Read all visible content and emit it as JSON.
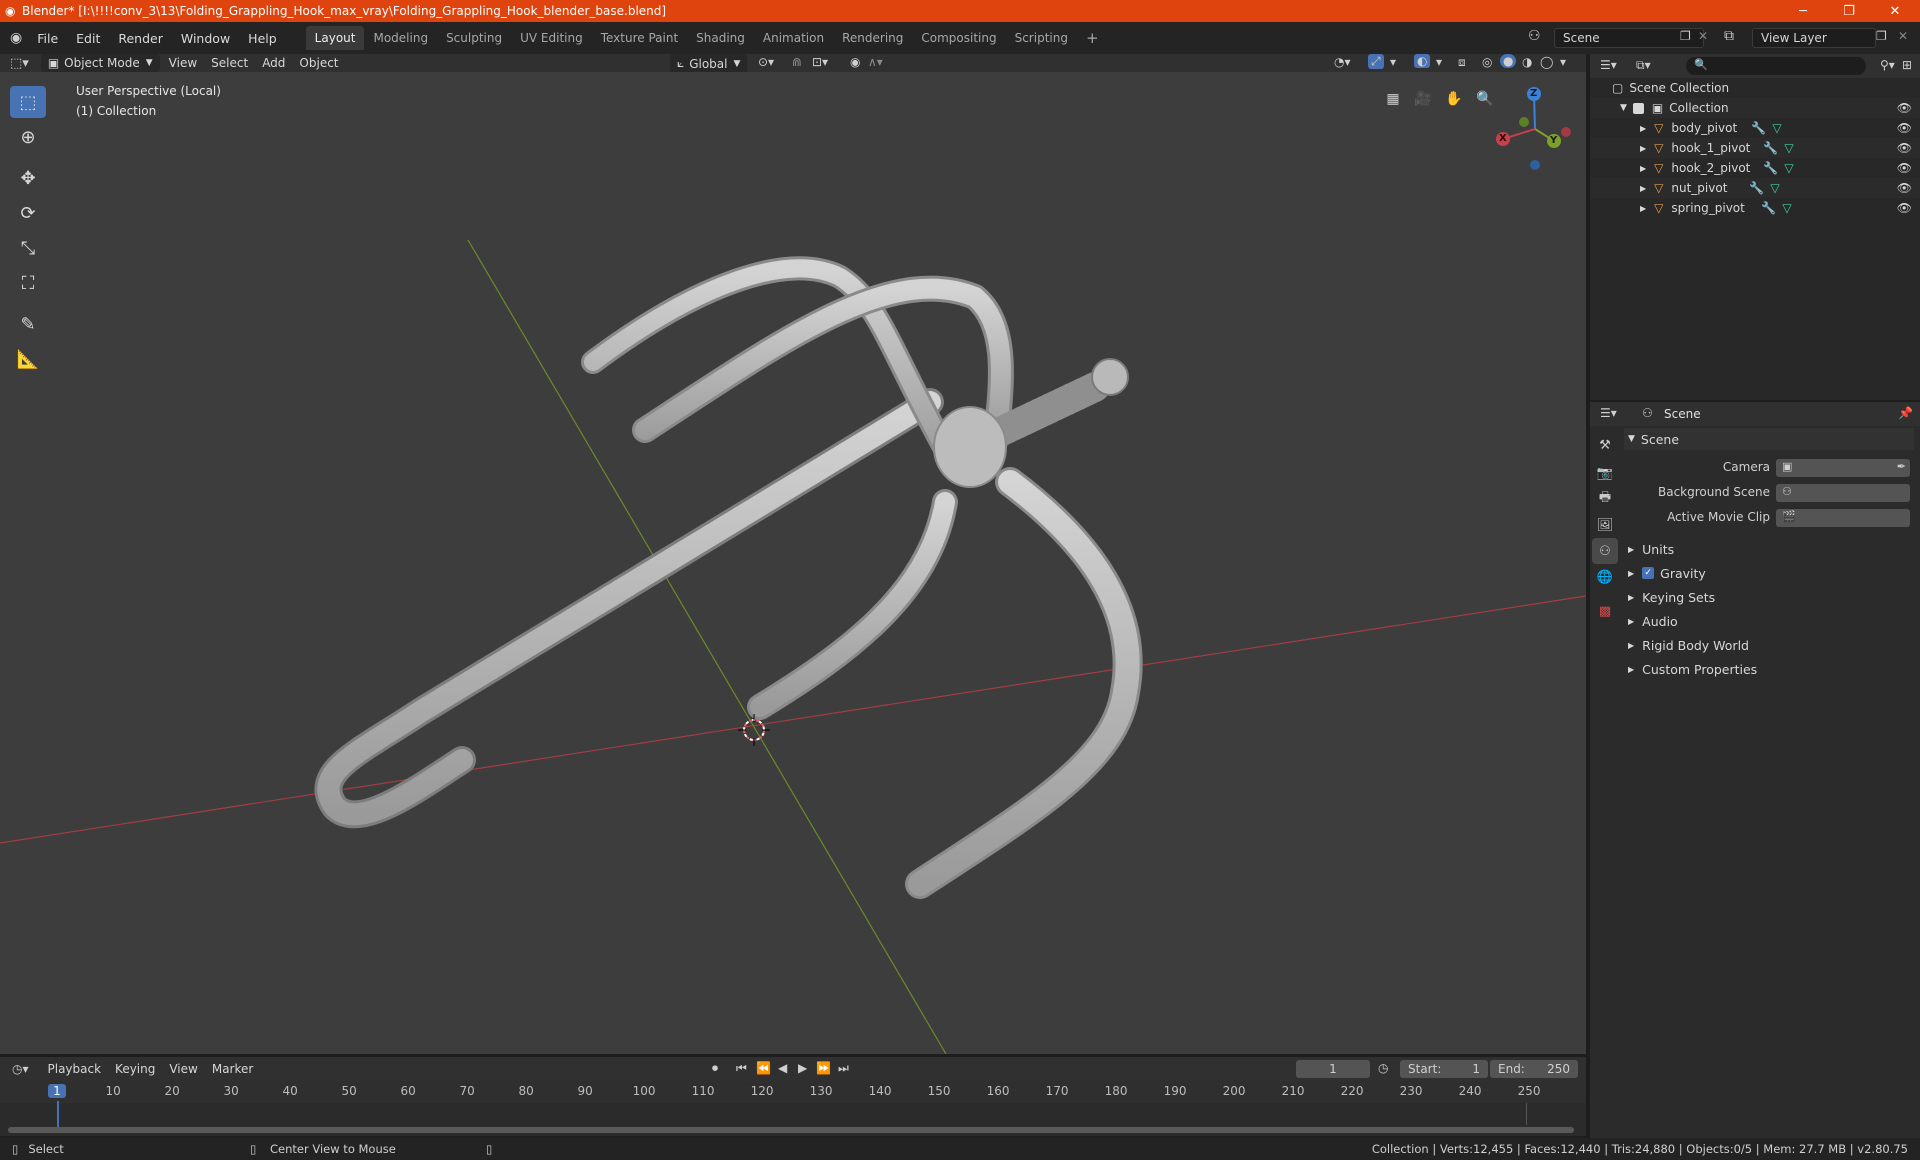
{
  "window": {
    "title": "Blender* [I:\\!!!!conv_3\\13\\Folding_Grappling_Hook_max_vray\\Folding_Grappling_Hook_blender_base.blend]",
    "minimize": "─",
    "maximize": "❐",
    "close": "✕"
  },
  "menu": [
    "File",
    "Edit",
    "Render",
    "Window",
    "Help"
  ],
  "workspaces": [
    "Layout",
    "Modeling",
    "Sculpting",
    "UV Editing",
    "Texture Paint",
    "Shading",
    "Animation",
    "Rendering",
    "Compositing",
    "Scripting"
  ],
  "workspace_add": "+",
  "scene_field": "Scene",
  "view_layer_field": "View Layer",
  "viewport_header": {
    "mode": "Object Mode",
    "menus": [
      "View",
      "Select",
      "Add",
      "Object"
    ],
    "transform_orientation": "Global"
  },
  "viewport": {
    "perspective_label": "User Perspective (Local)",
    "collection_label": "(1) Collection",
    "gizmo": {
      "z": "Z",
      "y": "Y",
      "x": "X"
    }
  },
  "outliner": {
    "root": "Scene Collection",
    "collection": "Collection",
    "objects": [
      "body_pivot",
      "hook_1_pivot",
      "hook_2_pivot",
      "nut_pivot",
      "spring_pivot"
    ]
  },
  "properties": {
    "context": "Scene",
    "panel_title": "Scene",
    "fields": [
      {
        "label": "Camera"
      },
      {
        "label": "Background Scene"
      },
      {
        "label": "Active Movie Clip"
      }
    ],
    "sections": [
      "Units",
      "Gravity",
      "Keying Sets",
      "Audio",
      "Rigid Body World",
      "Custom Properties"
    ]
  },
  "timeline": {
    "menus": [
      "Playback",
      "Keying",
      "View",
      "Marker"
    ],
    "current_frame": "1",
    "start_label": "Start:",
    "start": "1",
    "end_label": "End:",
    "end": "250",
    "ruler": [
      "1",
      "10",
      "20",
      "30",
      "40",
      "50",
      "60",
      "70",
      "80",
      "90",
      "100",
      "110",
      "120",
      "130",
      "140",
      "150",
      "160",
      "170",
      "180",
      "190",
      "200",
      "210",
      "220",
      "230",
      "240",
      "250"
    ]
  },
  "status": {
    "left_action": "Select",
    "mid_action": "Center View to Mouse",
    "stats": "Collection | Verts:12,455 | Faces:12,440 | Tris:24,880 | Objects:0/5 | Mem: 27.7 MB | v2.80.75"
  },
  "colors": {
    "titlebar": "#e0440e",
    "accent": "#4772b3",
    "x_axis": "#c6404a",
    "y_axis": "#7ea02a",
    "z_axis": "#3b82d8"
  }
}
